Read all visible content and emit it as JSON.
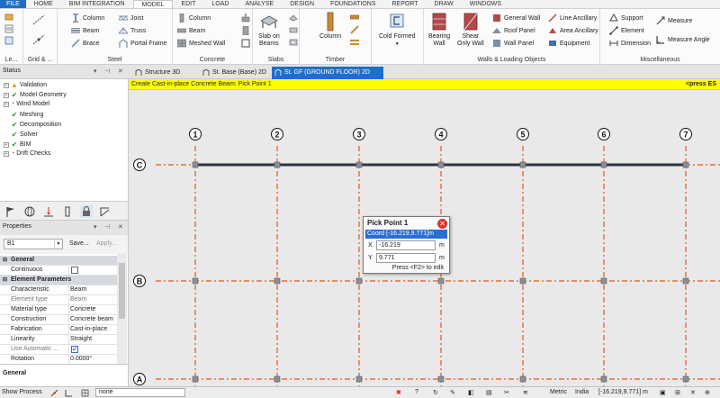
{
  "menu": {
    "items": [
      "FILE",
      "HOME",
      "BIM INTEGRATION",
      "MODEL",
      "EDIT",
      "LOAD",
      "ANALYSE",
      "DESIGN",
      "FOUNDATIONS",
      "REPORT",
      "DRAW",
      "WINDOWS"
    ],
    "active": "MODEL"
  },
  "ribbon": {
    "groups": {
      "levels": "Le...",
      "grid": "Grid & ...",
      "steel": "Steel",
      "concrete": "Concrete",
      "slabs": "Slabs",
      "timber": "Timber",
      "walls": "Walls & Loading Objects",
      "misc": "Miscellaneous"
    },
    "steel": {
      "column": "Column",
      "beam": "Beam",
      "brace": "Brace",
      "joist": "Joist",
      "truss": "Truss",
      "portal_frame": "Portal Frame"
    },
    "concrete": {
      "column": "Column",
      "beam": "Beam",
      "meshed_wall": "Meshed Wall"
    },
    "slabs": {
      "slab_on_beams_1": "Slab on",
      "slab_on_beams_2": "Beams"
    },
    "timber": {
      "column": "Column"
    },
    "cold_formed": "Cold Formed",
    "walls": {
      "bearing_1": "Bearing",
      "bearing_2": "Wall",
      "shear_1": "Shear",
      "shear_2": "Only Wall",
      "general_wall": "General Wall",
      "roof_panel": "Roof Panel",
      "wall_panel": "Wall Panel",
      "line_ancillary": "Line Ancillary",
      "area_ancillary": "Area Ancillary",
      "equipment": "Equipment"
    },
    "misc": {
      "support": "Support",
      "element": "Element",
      "dimension": "Dimension",
      "measure": "Measure",
      "measure_angle": "Measure Angle"
    }
  },
  "status_panel": {
    "title": "Status",
    "items": [
      "Validation",
      "Model Geometry",
      "Wind Model",
      "Meshing",
      "Decomposition",
      "Solver",
      "BIM",
      "Drift Checks"
    ]
  },
  "doc_tabs": [
    "Structure 3D",
    "St. Base (Base) 2D",
    "St. GF (GROUND FLOOR) 2D"
  ],
  "command_prompt": {
    "text": "Create Cast-in-place Concrete Beam: Pick Point 1",
    "hint": "<press ES"
  },
  "properties": {
    "title": "Properties",
    "selection": "B1",
    "save": "Save...",
    "apply": "Apply...",
    "rows": [
      {
        "type": "section",
        "key": "General",
        "value": ""
      },
      {
        "type": "check",
        "key": "Continuous",
        "value": ""
      },
      {
        "type": "section",
        "key": "Element Parameters",
        "value": ""
      },
      {
        "type": "row",
        "key": "Characteristic",
        "value": "Beam"
      },
      {
        "type": "row",
        "key": "Element type",
        "value": "Beam"
      },
      {
        "type": "row",
        "key": "Material type",
        "value": "Concrete"
      },
      {
        "type": "row",
        "key": "Construction",
        "value": "Concrete beam"
      },
      {
        "type": "row",
        "key": "Fabrication",
        "value": "Cast-in-place"
      },
      {
        "type": "row",
        "key": "Linearity",
        "value": "Straight"
      },
      {
        "type": "check",
        "key": "Use Automatic ...",
        "value": ""
      },
      {
        "type": "row",
        "key": "Rotation",
        "value": "0.0000°"
      }
    ],
    "description": "General"
  },
  "grid": {
    "columns": [
      "1",
      "2",
      "3",
      "4",
      "5",
      "6",
      "7"
    ],
    "rows": [
      "C",
      "B",
      "A"
    ]
  },
  "pick_point": {
    "title": "Pick Point 1",
    "coord": "Coord [-16.219,9.771]m",
    "x_label": "X",
    "x_value": "-16.219",
    "y_label": "Y",
    "y_value": "9.771",
    "unit": "m",
    "hint": "Press <F2> to edit"
  },
  "statusbar": {
    "show_process": "Show Process",
    "input_value": "none",
    "units": "Metric",
    "region": "India",
    "coord": "[-16.219,9.771] m"
  },
  "colors": {
    "accent": "#1f6fc4",
    "prompt": "#ffff00",
    "grid_line": "#e2581c",
    "beam": "#2e3440"
  }
}
